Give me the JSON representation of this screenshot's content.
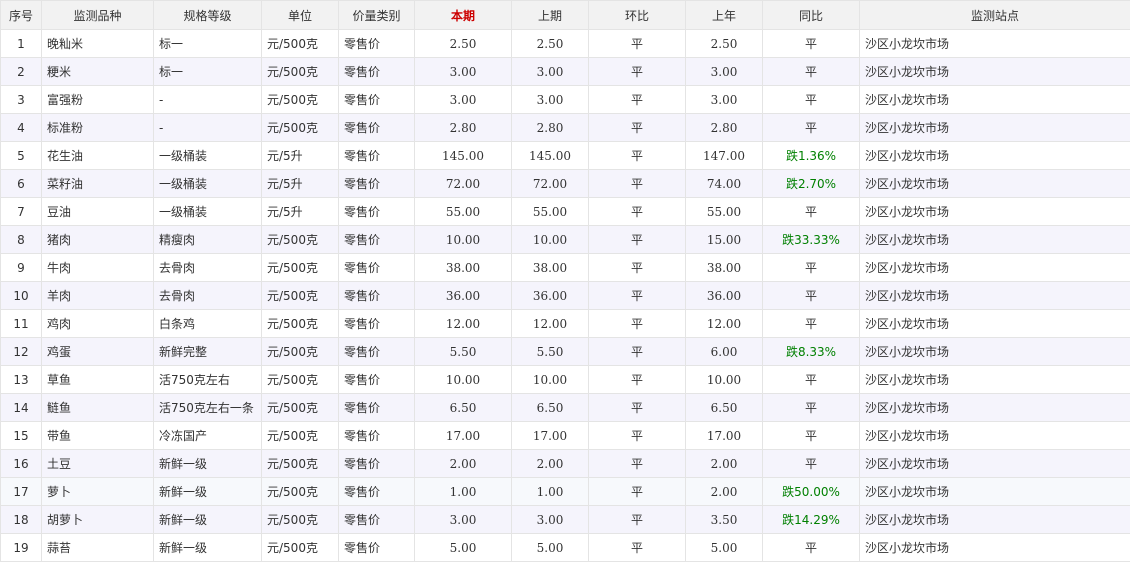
{
  "table": {
    "headers": [
      "序号",
      "监测品种",
      "规格等级",
      "单位",
      "价量类别",
      "本期",
      "上期",
      "环比",
      "上年",
      "同比",
      "监测站点"
    ],
    "colors": {
      "current_period_header": "#cc0000",
      "fall_text": "#008000",
      "alt_row": "#f5f4fc",
      "header_bg": "#f2f2f2"
    },
    "rows": [
      [
        "1",
        "晚籼米",
        "标一",
        "元/500克",
        "零售价",
        "2.50",
        "2.50",
        "平",
        "2.50",
        "平",
        "沙区小龙坎市场"
      ],
      [
        "2",
        "粳米",
        "标一",
        "元/500克",
        "零售价",
        "3.00",
        "3.00",
        "平",
        "3.00",
        "平",
        "沙区小龙坎市场"
      ],
      [
        "3",
        "富强粉",
        "-",
        "元/500克",
        "零售价",
        "3.00",
        "3.00",
        "平",
        "3.00",
        "平",
        "沙区小龙坎市场"
      ],
      [
        "4",
        "标准粉",
        "-",
        "元/500克",
        "零售价",
        "2.80",
        "2.80",
        "平",
        "2.80",
        "平",
        "沙区小龙坎市场"
      ],
      [
        "5",
        "花生油",
        "一级桶装",
        "元/5升",
        "零售价",
        "145.00",
        "145.00",
        "平",
        "147.00",
        "跌1.36%",
        "沙区小龙坎市场"
      ],
      [
        "6",
        "菜籽油",
        "一级桶装",
        "元/5升",
        "零售价",
        "72.00",
        "72.00",
        "平",
        "74.00",
        "跌2.70%",
        "沙区小龙坎市场"
      ],
      [
        "7",
        "豆油",
        "一级桶装",
        "元/5升",
        "零售价",
        "55.00",
        "55.00",
        "平",
        "55.00",
        "平",
        "沙区小龙坎市场"
      ],
      [
        "8",
        "猪肉",
        "精瘦肉",
        "元/500克",
        "零售价",
        "10.00",
        "10.00",
        "平",
        "15.00",
        "跌33.33%",
        "沙区小龙坎市场"
      ],
      [
        "9",
        "牛肉",
        "去骨肉",
        "元/500克",
        "零售价",
        "38.00",
        "38.00",
        "平",
        "38.00",
        "平",
        "沙区小龙坎市场"
      ],
      [
        "10",
        "羊肉",
        "去骨肉",
        "元/500克",
        "零售价",
        "36.00",
        "36.00",
        "平",
        "36.00",
        "平",
        "沙区小龙坎市场"
      ],
      [
        "11",
        "鸡肉",
        "白条鸡",
        "元/500克",
        "零售价",
        "12.00",
        "12.00",
        "平",
        "12.00",
        "平",
        "沙区小龙坎市场"
      ],
      [
        "12",
        "鸡蛋",
        "新鲜完整",
        "元/500克",
        "零售价",
        "5.50",
        "5.50",
        "平",
        "6.00",
        "跌8.33%",
        "沙区小龙坎市场"
      ],
      [
        "13",
        "草鱼",
        "活750克左右",
        "元/500克",
        "零售价",
        "10.00",
        "10.00",
        "平",
        "10.00",
        "平",
        "沙区小龙坎市场"
      ],
      [
        "14",
        "鲢鱼",
        "活750克左右一条",
        "元/500克",
        "零售价",
        "6.50",
        "6.50",
        "平",
        "6.50",
        "平",
        "沙区小龙坎市场"
      ],
      [
        "15",
        "带鱼",
        "冷冻国产",
        "元/500克",
        "零售价",
        "17.00",
        "17.00",
        "平",
        "17.00",
        "平",
        "沙区小龙坎市场"
      ],
      [
        "16",
        "土豆",
        "新鲜一级",
        "元/500克",
        "零售价",
        "2.00",
        "2.00",
        "平",
        "2.00",
        "平",
        "沙区小龙坎市场"
      ],
      [
        "17",
        "萝卜",
        "新鲜一级",
        "元/500克",
        "零售价",
        "1.00",
        "1.00",
        "平",
        "2.00",
        "跌50.00%",
        "沙区小龙坎市场"
      ],
      [
        "18",
        "胡萝卜",
        "新鲜一级",
        "元/500克",
        "零售价",
        "3.00",
        "3.00",
        "平",
        "3.50",
        "跌14.29%",
        "沙区小龙坎市场"
      ],
      [
        "19",
        "蒜苔",
        "新鲜一级",
        "元/500克",
        "零售价",
        "5.00",
        "5.00",
        "平",
        "5.00",
        "平",
        "沙区小龙坎市场"
      ]
    ]
  }
}
